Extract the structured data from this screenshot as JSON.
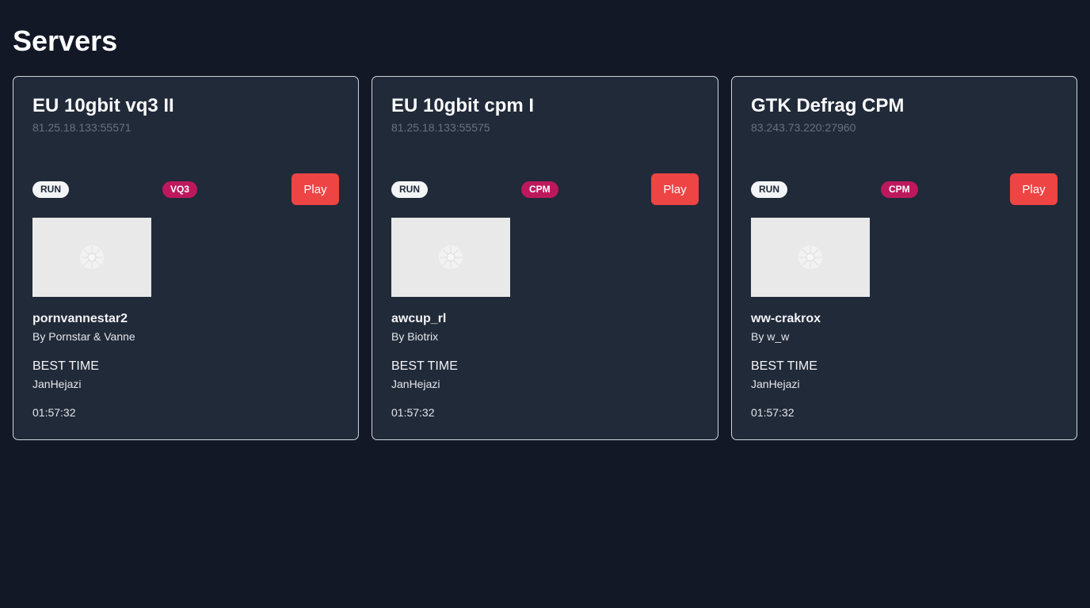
{
  "page": {
    "title": "Servers"
  },
  "servers": [
    {
      "name": "EU 10gbit vq3 II",
      "address": "81.25.18.133:55571",
      "run_badge": "RUN",
      "mode_badge": "VQ3",
      "play_label": "Play",
      "map_name": "pornvannestar2",
      "map_author": "By Pornstar & Vanne",
      "best_time_label": "BEST TIME",
      "best_player": "JanHejazi",
      "best_time": "01:57:32"
    },
    {
      "name": "EU 10gbit cpm I",
      "address": "81.25.18.133:55575",
      "run_badge": "RUN",
      "mode_badge": "CPM",
      "play_label": "Play",
      "map_name": "awcup_rl",
      "map_author": "By Biotrix",
      "best_time_label": "BEST TIME",
      "best_player": "JanHejazi",
      "best_time": "01:57:32"
    },
    {
      "name": "GTK Defrag CPM",
      "address": "83.243.73.220:27960",
      "run_badge": "RUN",
      "mode_badge": "CPM",
      "play_label": "Play",
      "map_name": "ww-crakrox",
      "map_author": "By w_w",
      "best_time_label": "BEST TIME",
      "best_player": "JanHejazi",
      "best_time": "01:57:32"
    }
  ],
  "colors": {
    "background": "#121826",
    "card": "#212a39",
    "play_button": "#ef4444",
    "mode_badge": "#be185d",
    "thumbnail_placeholder": "#e9e9e9"
  },
  "icons": {
    "thumbnail": "image-placeholder-icon"
  }
}
